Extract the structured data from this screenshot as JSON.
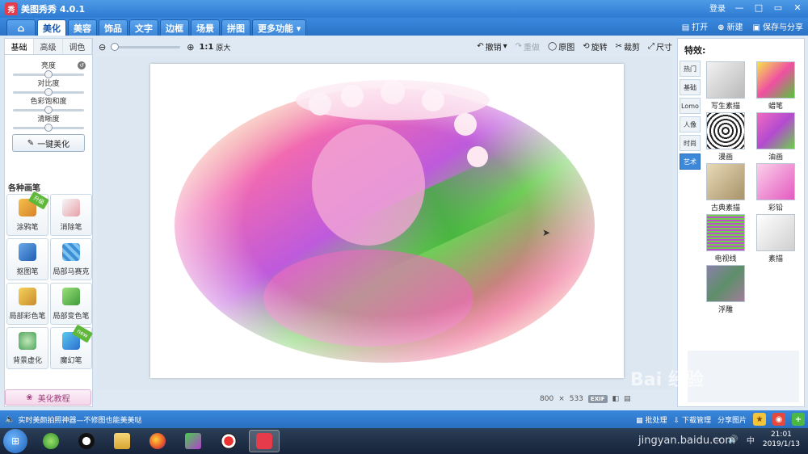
{
  "app": {
    "logo": "秀",
    "title": "美图秀秀 4.0.1"
  },
  "titlebar": {
    "login": "登录",
    "min": "—",
    "restore": "□",
    "max": "▭",
    "close": "✕"
  },
  "nav": {
    "tabs": [
      "美化",
      "美容",
      "饰品",
      "文字",
      "边框",
      "场景",
      "拼图",
      "更多功能 ▾"
    ],
    "open": "打开",
    "new": "新建",
    "save_share": "保存与分享"
  },
  "left": {
    "subtabs": [
      "基础",
      "高级",
      "调色"
    ],
    "sliders": [
      {
        "label": "亮度",
        "value": 0.5
      },
      {
        "label": "对比度",
        "value": 0.5
      },
      {
        "label": "色彩饱和度",
        "value": 0.5
      },
      {
        "label": "清晰度",
        "value": 0.5
      }
    ],
    "onekey": "一键美化",
    "brushes_title": "各种画笔",
    "tools": [
      {
        "label": "涂鸦笔",
        "badge": "升级"
      },
      {
        "label": "消除笔",
        "badge": ""
      },
      {
        "label": "抠图笔",
        "badge": ""
      },
      {
        "label": "局部马赛克",
        "badge": ""
      },
      {
        "label": "局部彩色笔",
        "badge": ""
      },
      {
        "label": "局部变色笔",
        "badge": ""
      },
      {
        "label": "背景虚化",
        "badge": ""
      },
      {
        "label": "魔幻笔",
        "badge": "new"
      }
    ],
    "tutorial": "美化教程"
  },
  "toolbar": {
    "ratio": "1:1",
    "original": "原大",
    "undo": "撤销",
    "redo": "重做",
    "reset": "原图",
    "rotate": "旋转",
    "crop": "裁剪",
    "size": "尺寸"
  },
  "canvas": {
    "width_px": "800",
    "times": "×",
    "height_px": "533",
    "exif": "EXIF"
  },
  "right": {
    "title": "特效:",
    "tabs": [
      "热门",
      "基础",
      "Lomo",
      "人像",
      "时尚",
      "艺术"
    ],
    "active_tab": 5,
    "effects": [
      "写生素描",
      "蜡笔",
      "漫画",
      "油画",
      "古典素描",
      "彩铅",
      "电视线",
      "素描",
      "浮雕"
    ]
  },
  "bottombar": {
    "message": "实时美颜拍照神器—不修图也能美美哒",
    "batch": "批处理",
    "download": "下载管理",
    "share": "分享图片"
  },
  "taskbar": {
    "time": "21:01",
    "date": "2019/1/13"
  },
  "watermark": {
    "brand": "Bai 经验",
    "url": "jingyan.baidu.com"
  }
}
